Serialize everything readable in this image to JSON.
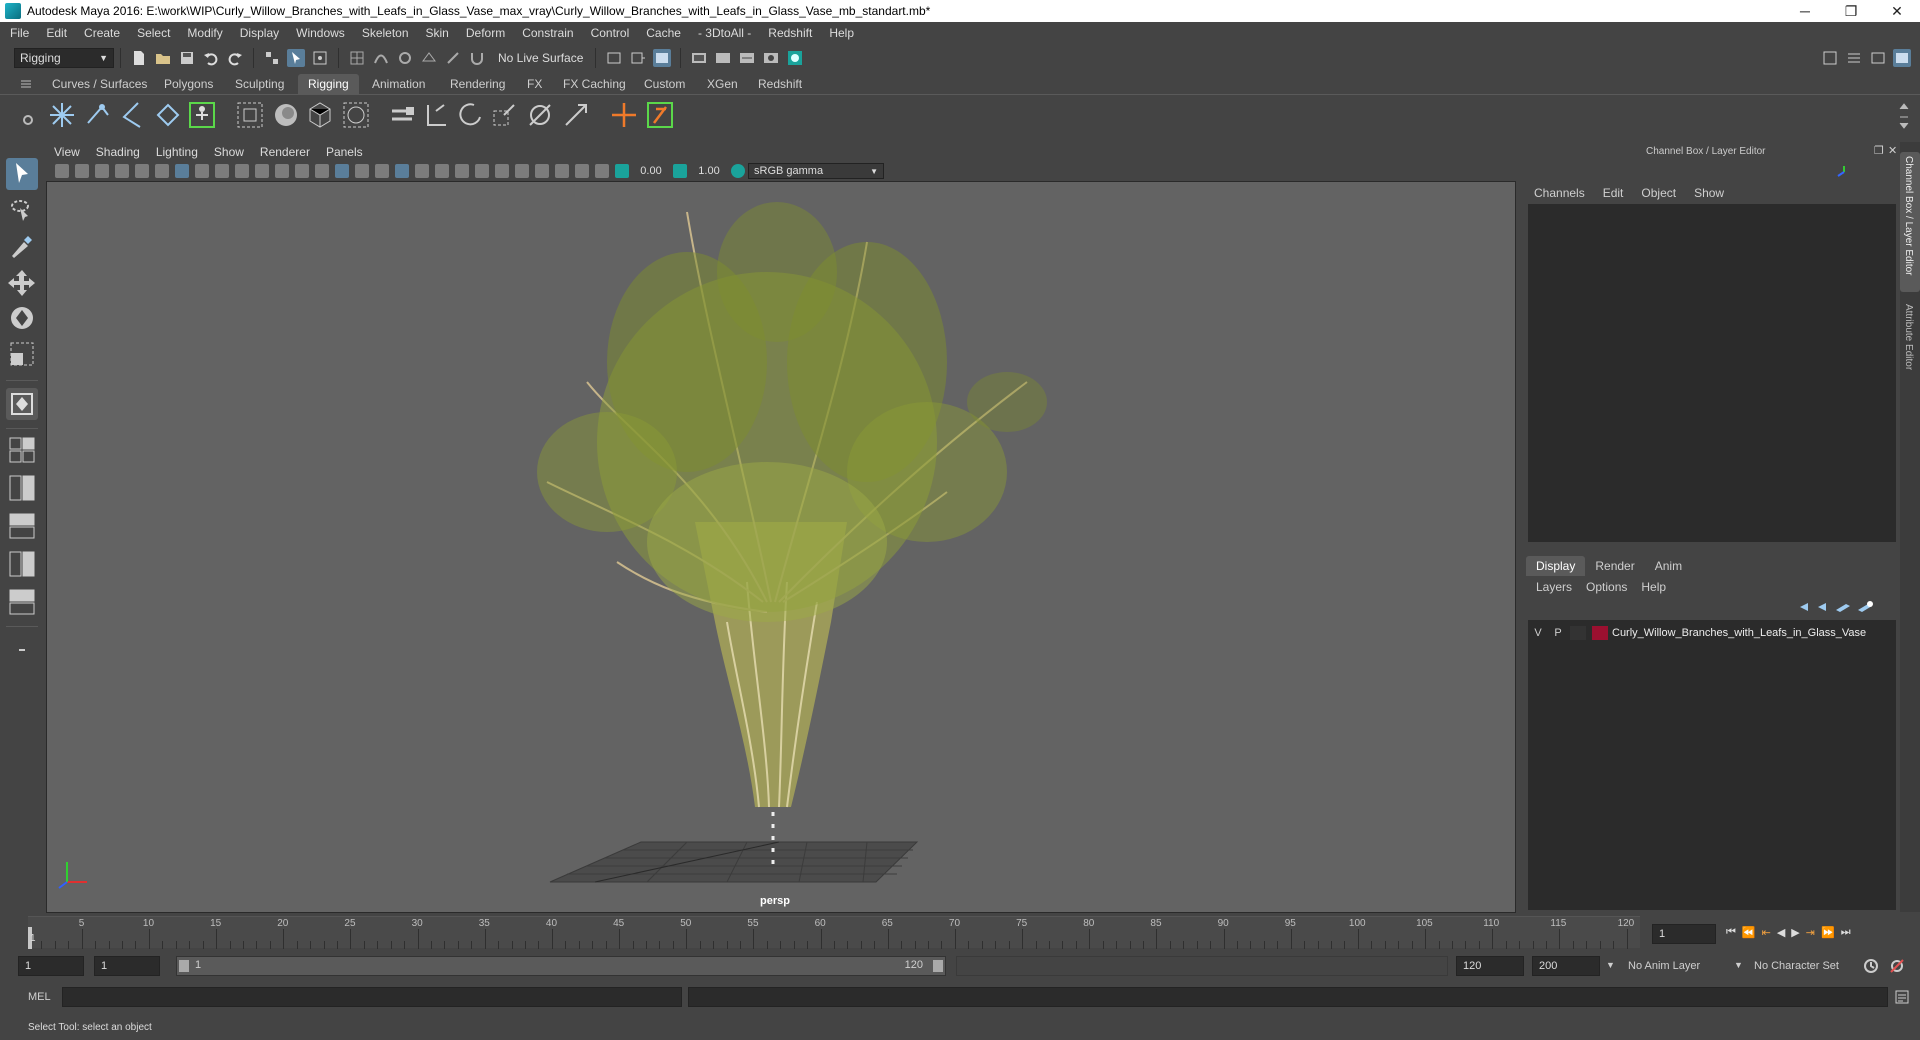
{
  "window": {
    "title": "Autodesk Maya 2016: E:\\work\\WIP\\Curly_Willow_Branches_with_Leafs_in_Glass_Vase_max_vray\\Curly_Willow_Branches_with_Leafs_in_Glass_Vase_mb_standart.mb*",
    "minimize": "─",
    "restore": "❐",
    "close": "✕"
  },
  "menus": [
    "File",
    "Edit",
    "Create",
    "Select",
    "Modify",
    "Display",
    "Windows",
    "Skeleton",
    "Skin",
    "Deform",
    "Constrain",
    "Control",
    "Cache",
    "- 3DtoAll -",
    "Redshift",
    "Help"
  ],
  "status_line": {
    "mode": "Rigging",
    "live_surface": "No Live Surface"
  },
  "shelf_tabs": [
    "Curves / Surfaces",
    "Polygons",
    "Sculpting",
    "Rigging",
    "Animation",
    "Rendering",
    "FX",
    "FX Caching",
    "Custom",
    "XGen",
    "Redshift"
  ],
  "shelf_active": "Rigging",
  "viewport": {
    "menus": [
      "View",
      "Shading",
      "Lighting",
      "Show",
      "Renderer",
      "Panels"
    ],
    "exposure": "0.00",
    "gamma": "1.00",
    "color_space": "sRGB gamma",
    "camera_label": "persp"
  },
  "channel_box": {
    "title": "Channel Box / Layer Editor",
    "menus": [
      "Channels",
      "Edit",
      "Object",
      "Show"
    ],
    "layer_tabs": [
      "Display",
      "Render",
      "Anim"
    ],
    "layer_menus": [
      "Layers",
      "Options",
      "Help"
    ],
    "layer": {
      "visible": "V",
      "playback": "P",
      "name": "Curly_Willow_Branches_with_Leafs_in_Glass_Vase",
      "color": "#9b1030"
    },
    "side_tabs": [
      "Channel Box / Layer Editor",
      "Attribute Editor"
    ]
  },
  "timeline": {
    "ticks": [
      "5",
      "10",
      "15",
      "20",
      "25",
      "30",
      "35",
      "40",
      "45",
      "50",
      "55",
      "60",
      "65",
      "70",
      "75",
      "80",
      "85",
      "90",
      "95",
      "100",
      "105",
      "110",
      "115",
      "120"
    ],
    "start_label": "1",
    "current_frame": "1"
  },
  "range": {
    "start": "1",
    "playback_start": "1",
    "slider_start": "1",
    "slider_end": "120",
    "playback_end": "120",
    "end": "200",
    "anim_layer": "No Anim Layer",
    "character_set": "No Character Set"
  },
  "command_line": {
    "label": "MEL"
  },
  "help_line": "Select Tool: select an object"
}
